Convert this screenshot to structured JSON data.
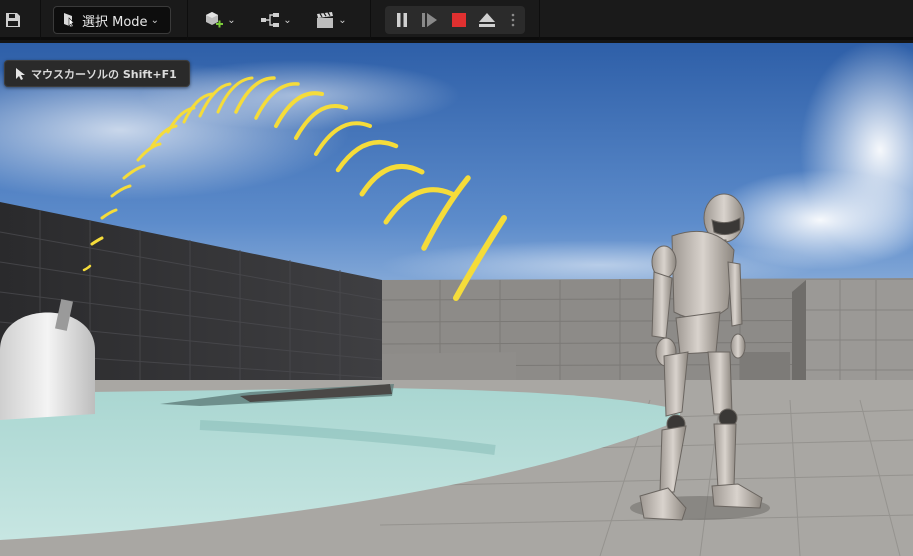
{
  "toolbar": {
    "mode_label": "選択 Mode",
    "icons": [
      "save-icon",
      "select-mode-icon",
      "add-actor-icon",
      "blueprint-icon",
      "cinematics-icon",
      "pause-icon",
      "frame-skip-icon",
      "stop-icon",
      "eject-icon",
      "more-options-icon"
    ],
    "stop_color": "#e03030"
  },
  "viewport": {
    "tooltip_text": "マウスカーソルの Shift+F1",
    "sky_top_color": "#2e5fa8",
    "ground_color": "#a9a7a3",
    "water_color": "#b7dcd8",
    "arc_color": "#f5dc3a"
  }
}
